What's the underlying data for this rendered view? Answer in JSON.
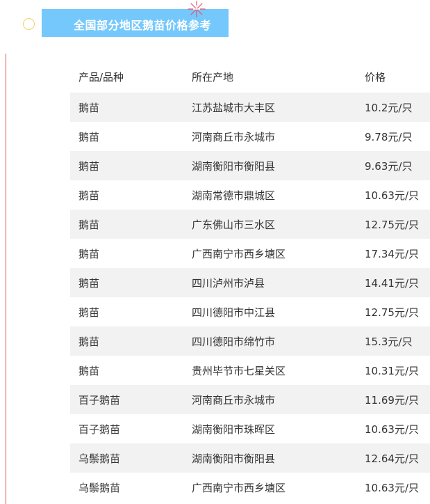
{
  "title": "全国部分地区鹅苗价格参考",
  "colors": {
    "banner": "#75c8fb",
    "row_shade": "#f2f2f2",
    "left_rule": "#d9534f",
    "circle": "#f2d16b"
  },
  "table": {
    "headers": [
      "产品/品种",
      "所在产地",
      "价格"
    ],
    "rows": [
      [
        "鹅苗",
        "江苏盐城市大丰区",
        "10.2元/只"
      ],
      [
        "鹅苗",
        "河南商丘市永城市",
        "9.78元/只"
      ],
      [
        "鹅苗",
        "湖南衡阳市衡阳县",
        "9.63元/只"
      ],
      [
        "鹅苗",
        "湖南常德市鼎城区",
        "10.63元/只"
      ],
      [
        "鹅苗",
        "广东佛山市三水区",
        "12.75元/只"
      ],
      [
        "鹅苗",
        "广西南宁市西乡塘区",
        "17.34元/只"
      ],
      [
        "鹅苗",
        "四川泸州市泸县",
        "14.41元/只"
      ],
      [
        "鹅苗",
        "四川德阳市中江县",
        "12.75元/只"
      ],
      [
        "鹅苗",
        "四川德阳市绵竹市",
        "15.3元/只"
      ],
      [
        "鹅苗",
        "贵州毕节市七星关区",
        "10.31元/只"
      ],
      [
        "百子鹅苗",
        "河南商丘市永城市",
        "11.69元/只"
      ],
      [
        "百子鹅苗",
        "湖南衡阳市珠晖区",
        "10.63元/只"
      ],
      [
        "乌鬃鹅苗",
        "湖南衡阳市衡阳县",
        "12.64元/只"
      ],
      [
        "乌鬃鹅苗",
        "广西南宁市西乡塘区",
        "10.63元/只"
      ]
    ]
  }
}
